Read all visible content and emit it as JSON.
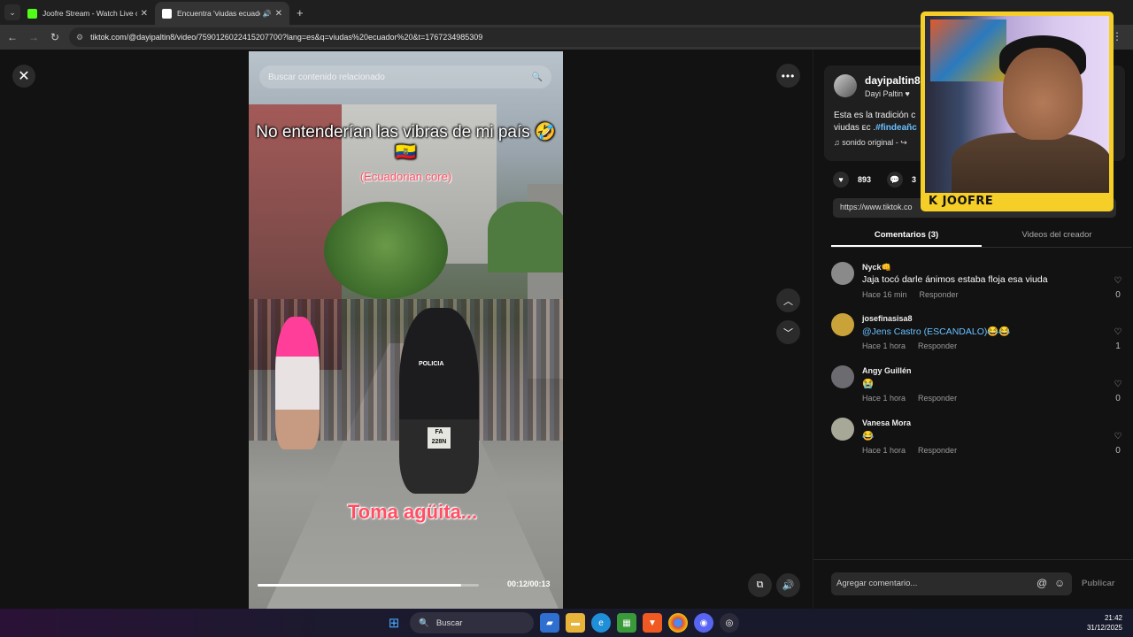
{
  "browser": {
    "tabs": [
      {
        "title": "Joofre Stream - Watch Live on K",
        "favicon_color": "#53fc18",
        "active": false
      },
      {
        "title": "Encuentra 'viudas ecuador'",
        "favicon_color": "#ffffff",
        "active": true
      }
    ],
    "url": "tiktok.com/@dayipaltin8/video/7590126022415207700?lang=es&q=viudas%20ecuador%20&t=1767234985309"
  },
  "video": {
    "search_placeholder": "Buscar contenido relacionado",
    "caption_main": "No entenderían las vibras de mi país 🤣🇪🇨",
    "caption_sub": "(Ecuadorian core)",
    "caption_bottom": "Toma agüita...",
    "police_label": "POLICIA",
    "plate": "FA 228N",
    "time": "00:12/00:13",
    "progress": 0.92
  },
  "post": {
    "username": "dayipaltin8",
    "display_name": "Dayi Paltin",
    "desc_line1": "Esta es la tradición c",
    "desc_line2_prefix": "viudas ᴇᴄ .",
    "desc_hashtag": "#findeañc",
    "sound": "sonido original - ↪",
    "likes": "893",
    "comments_count": "3",
    "share_url": "https://www.tiktok.co"
  },
  "panel_tabs": [
    {
      "label": "Comentarios (3)",
      "active": true
    },
    {
      "label": "Videos del creador",
      "active": false
    }
  ],
  "comments": [
    {
      "user": "Nyck👊",
      "text": "Jaja tocó darle ánimos estaba floja esa viuda",
      "time": "Hace 16 min",
      "reply": "Responder",
      "likes": "0",
      "avatar_color": "#8a8a8a",
      "mention": false
    },
    {
      "user": "josefinasisa8",
      "text": "@Jens Castro (ESCANDALO)😂😂",
      "time": "Hace 1 hora",
      "reply": "Responder",
      "likes": "1",
      "avatar_color": "#c9a23a",
      "mention": true
    },
    {
      "user": "Angy Guillén",
      "text": "😭",
      "time": "Hace 1 hora",
      "reply": "Responder",
      "likes": "0",
      "avatar_color": "#6c6c70",
      "mention": false
    },
    {
      "user": "Vanesa Mora",
      "text": "😂",
      "time": "Hace 1 hora",
      "reply": "Responder",
      "likes": "0",
      "avatar_color": "#a8a898",
      "mention": false
    }
  ],
  "comment_bar": {
    "placeholder": "Agregar comentario...",
    "publish_label": "Publicar"
  },
  "webcam": {
    "label": "K JOOFRE"
  },
  "taskbar": {
    "search_label": "Buscar",
    "time": "21:42",
    "date": "31/12/2025"
  }
}
